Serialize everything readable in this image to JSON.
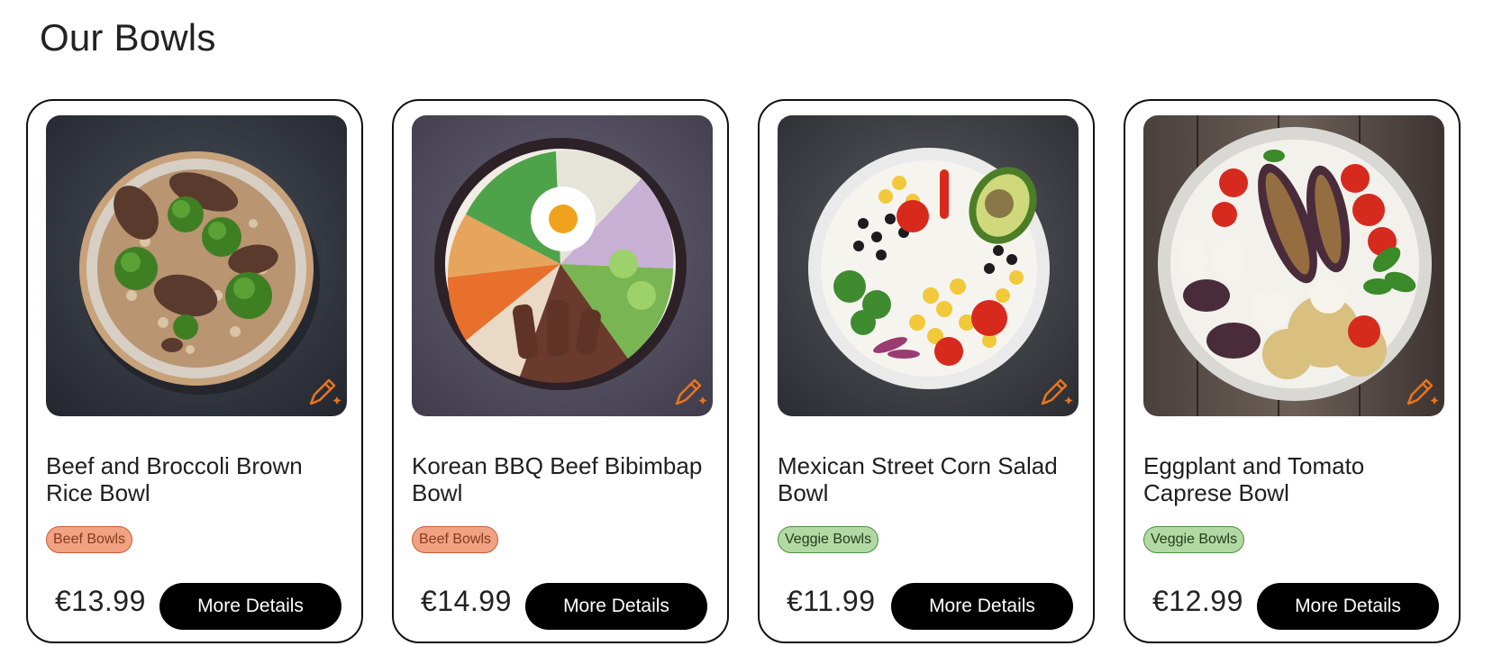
{
  "section_title": "Our Bowls",
  "colors": {
    "beef_tag_bg": "#f1a283",
    "veggie_tag_bg": "#b2d9a3",
    "button_bg": "#000000",
    "edit_icon": "#e8751e"
  },
  "cards": [
    {
      "name": "Beef and Broccoli Brown Rice Bowl",
      "category": "Beef Bowls",
      "category_type": "beef",
      "price": "€13.99",
      "button_label": "More Details",
      "image": "beef-broccoli-bowl-image",
      "edit_icon": "pencil-sparkle-icon"
    },
    {
      "name": "Korean BBQ Beef Bibimbap Bowl",
      "category": "Beef Bowls",
      "category_type": "beef",
      "price": "€14.99",
      "button_label": "More Details",
      "image": "bibimbap-bowl-image",
      "edit_icon": "pencil-sparkle-icon"
    },
    {
      "name": "Mexican Street Corn Salad Bowl",
      "category": "Veggie Bowls",
      "category_type": "veggie",
      "price": "€11.99",
      "button_label": "More Details",
      "image": "street-corn-salad-image",
      "edit_icon": "pencil-sparkle-icon"
    },
    {
      "name": "Eggplant and Tomato Caprese Bowl",
      "category": "Veggie Bowls",
      "category_type": "veggie",
      "price": "€12.99",
      "button_label": "More Details",
      "image": "eggplant-caprese-image",
      "edit_icon": "pencil-sparkle-icon"
    }
  ]
}
